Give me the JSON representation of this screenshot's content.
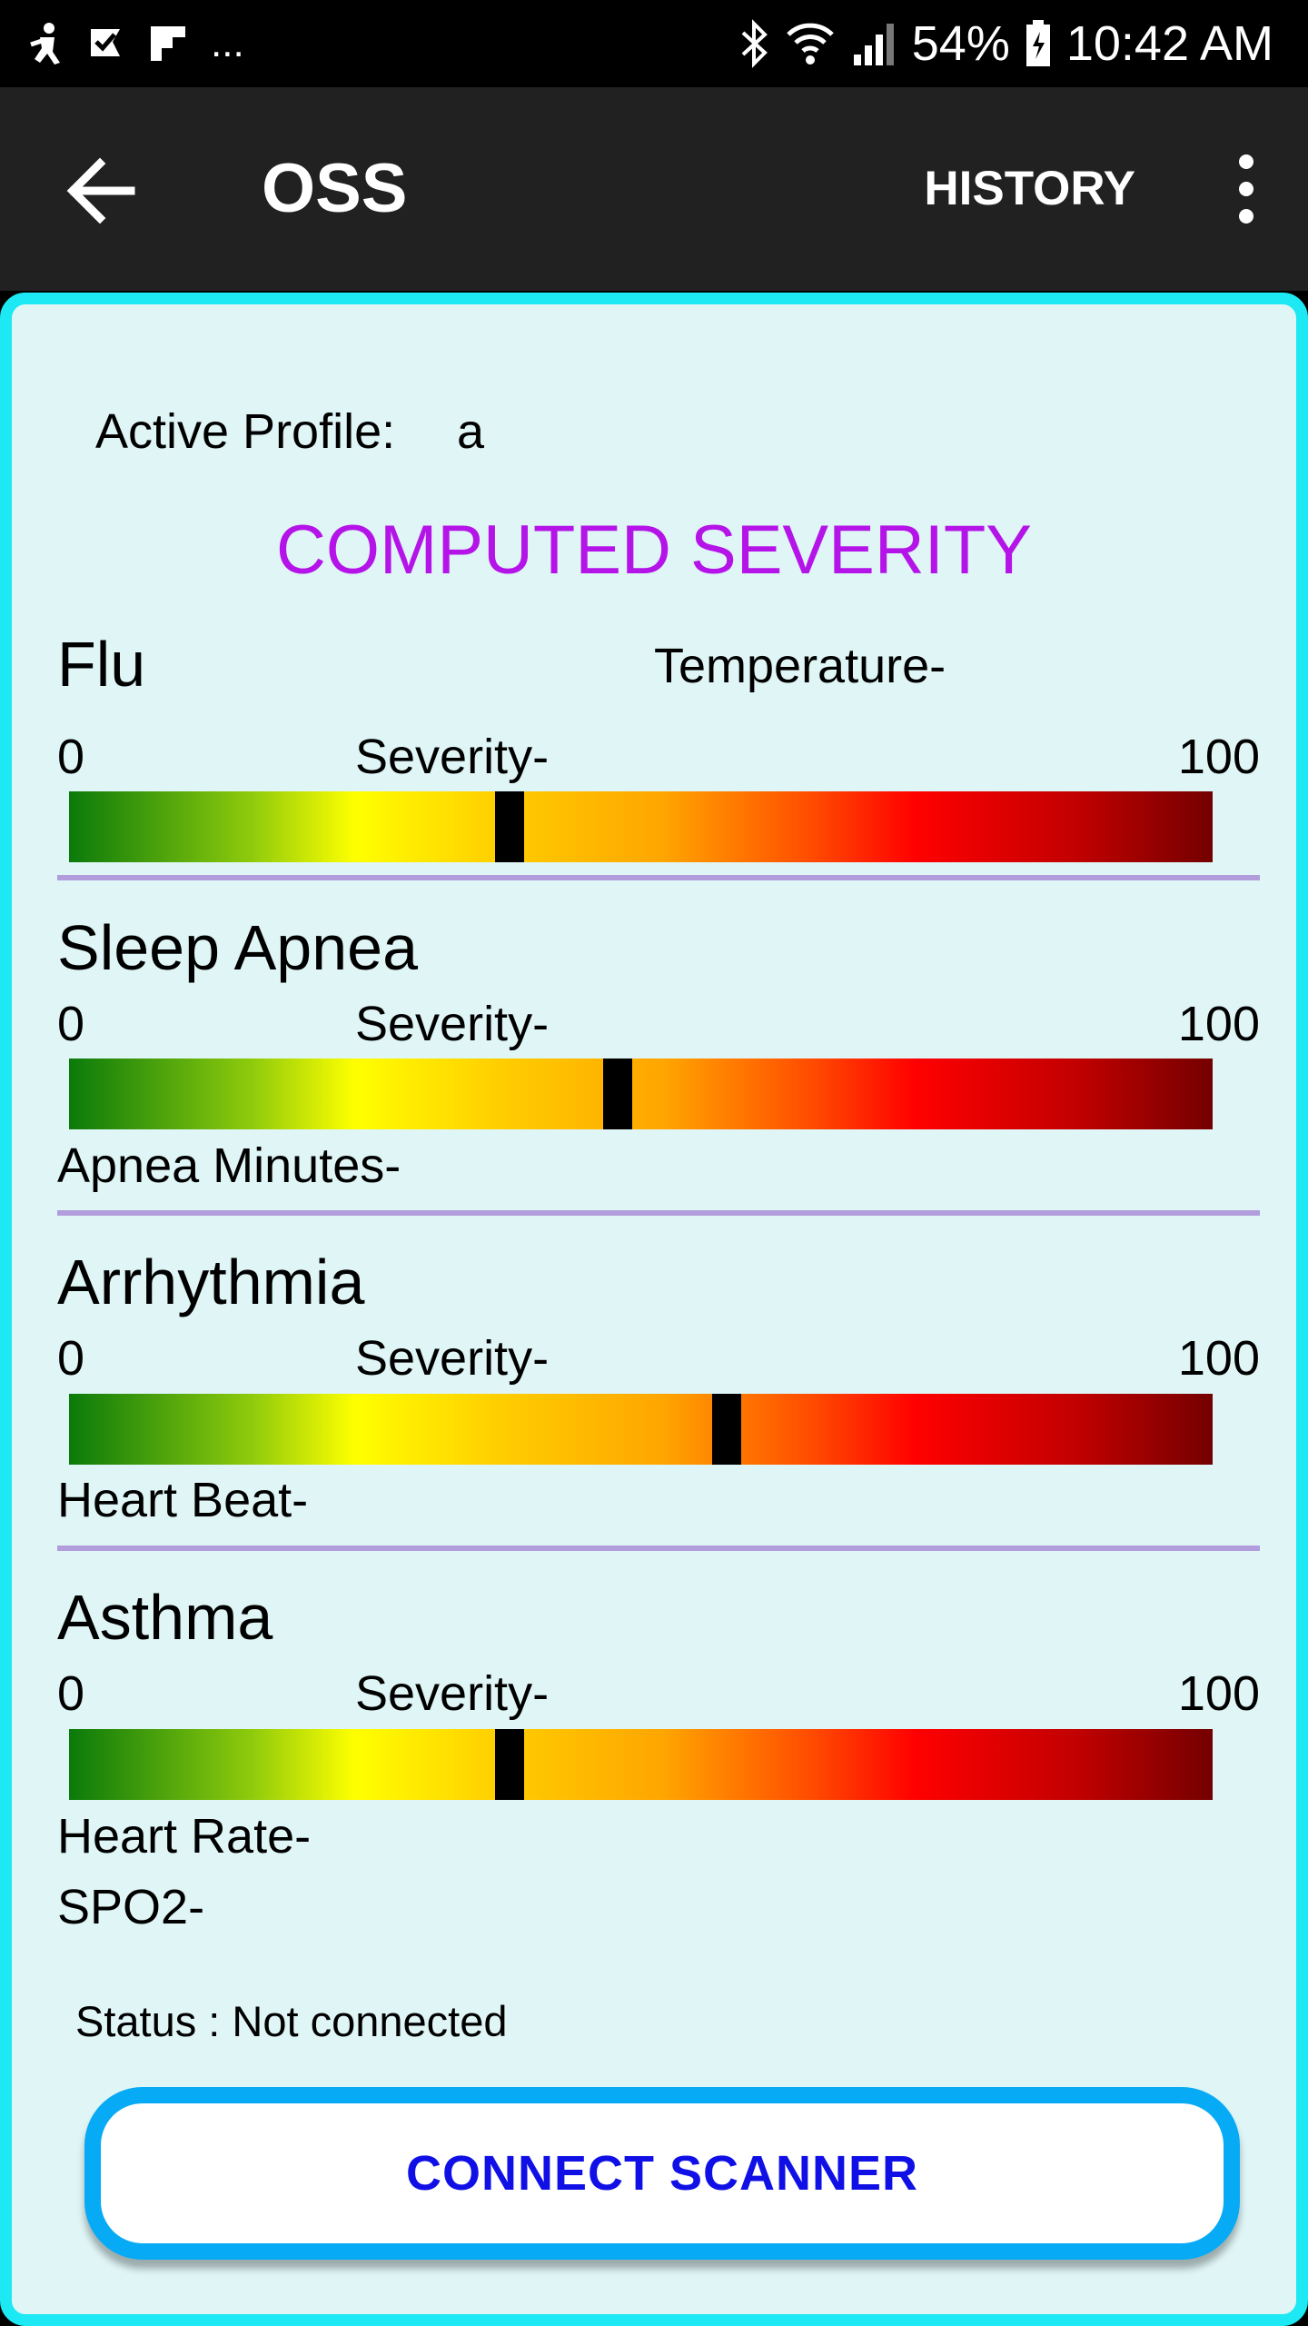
{
  "status_bar": {
    "more_indicator": "...",
    "battery_percent": "54%",
    "time": "10:42 AM"
  },
  "app_bar": {
    "title": "OSS",
    "history_label": "HISTORY"
  },
  "profile": {
    "label": "Active Profile:",
    "value": "a"
  },
  "heading": "COMPUTED SEVERITY",
  "conditions": [
    {
      "name": "Flu",
      "metric_labels": [
        "Temperature-"
      ],
      "severity_label": "Severity-",
      "min": "0",
      "max": "100",
      "severity_fraction": 0.385
    },
    {
      "name": "Sleep Apnea",
      "metric_labels": [
        "Apnea Minutes-"
      ],
      "severity_label": "Severity-",
      "min": "0",
      "max": "100",
      "severity_fraction": 0.48
    },
    {
      "name": "Arrhythmia",
      "metric_labels": [
        "Heart Beat-"
      ],
      "severity_label": "Severity-",
      "min": "0",
      "max": "100",
      "severity_fraction": 0.575
    },
    {
      "name": "Asthma",
      "metric_labels": [
        "Heart Rate-",
        "SPO2-"
      ],
      "severity_label": "Severity-",
      "min": "0",
      "max": "100",
      "severity_fraction": 0.385
    }
  ],
  "status": "Status : Not connected",
  "connect_button": "CONNECT SCANNER",
  "colors": {
    "heading": "#b514e8",
    "card_border": "#1ce9f3",
    "card_background": "#dff5f6",
    "button_border": "#07aaf5",
    "button_text": "#1010e6",
    "divider": "#b19ddb"
  },
  "icons": [
    "notification-app-icon",
    "check-flag-icon",
    "flipboard-icon",
    "bluetooth-icon",
    "wifi-icon",
    "signal-icon",
    "battery-icon",
    "back-arrow-icon",
    "overflow-menu-icon"
  ]
}
